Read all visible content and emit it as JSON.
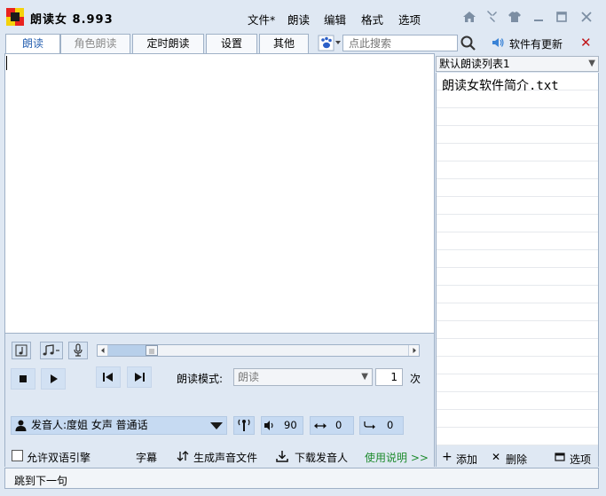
{
  "app": {
    "title": "朗读女 8.993"
  },
  "menu": [
    "文件*",
    "朗读",
    "编辑",
    "格式",
    "选项"
  ],
  "window_controls": [
    "home-icon",
    "pin-icon",
    "shirt-icon",
    "minimize-icon",
    "maximize-icon",
    "close-icon"
  ],
  "tabs": [
    {
      "label": "朗读",
      "state": "active"
    },
    {
      "label": "角色朗读",
      "state": "disabled"
    },
    {
      "label": "定时朗读",
      "state": "normal"
    },
    {
      "label": "设置",
      "state": "normal"
    },
    {
      "label": "其他",
      "state": "normal"
    }
  ],
  "search": {
    "placeholder": "点此搜索"
  },
  "update": {
    "label": "软件有更新"
  },
  "editor": {
    "text": ""
  },
  "playback": {
    "mode_label": "朗读模式:",
    "mode_value": "朗读",
    "repeat_count": "1",
    "repeat_unit": "次"
  },
  "voice": {
    "label": "发音人:度姐 女声 普通话",
    "volume": "90",
    "speed": "0",
    "pitch": "0"
  },
  "bottom": {
    "bilingual": "允许双语引擎",
    "subtitle": "字幕",
    "generate_audio": "生成声音文件",
    "download_voice": "下载发音人",
    "instructions": "使用说明 >>"
  },
  "playlist": {
    "selected": "默认朗读列表1",
    "items": [
      "朗读女软件简介.txt"
    ],
    "add": "添加",
    "delete": "删除",
    "options": "选项"
  },
  "status": {
    "text": "跳到下一句"
  },
  "colors": {
    "accent": "#2b63b2",
    "background": "#dfe8f3",
    "close_red": "#c0171b",
    "instructions_green": "#1e8b2e"
  }
}
